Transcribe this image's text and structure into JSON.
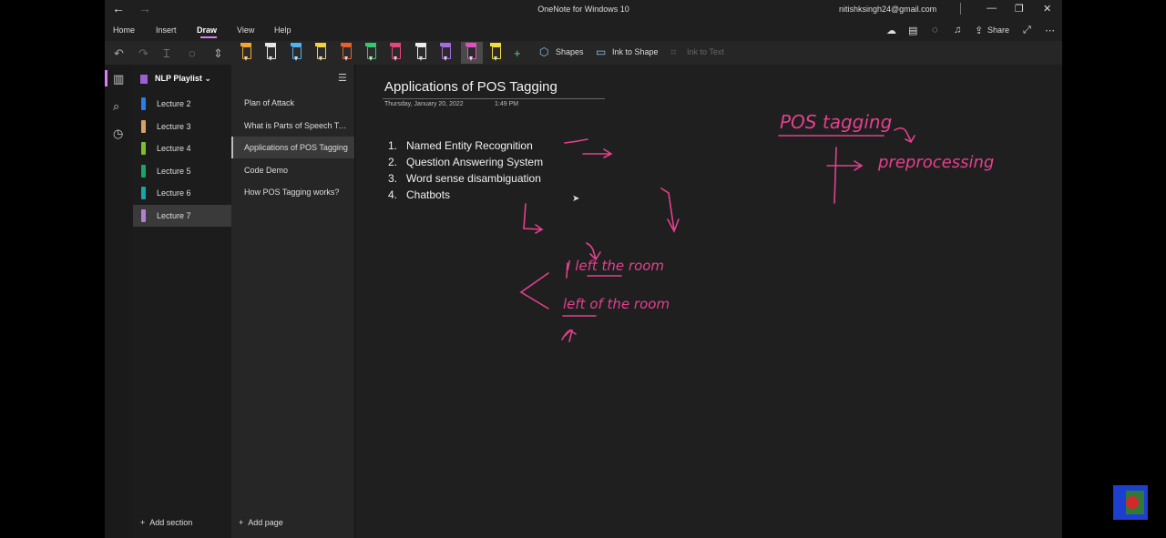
{
  "window": {
    "title": "OneNote for Windows 10",
    "account": "nitishksingh24@gmail.com"
  },
  "menu_tabs": [
    "Home",
    "Insert",
    "Draw",
    "View",
    "Help"
  ],
  "active_tab": "Draw",
  "top_actions": {
    "share_label": "Share"
  },
  "toolbar": {
    "pens": [
      {
        "color": "#f0a830"
      },
      {
        "color": "#e8e8e8"
      },
      {
        "color": "#4fb3ef"
      },
      {
        "color": "#f5d23a"
      },
      {
        "color": "#e8602c"
      },
      {
        "color": "#34c96c"
      },
      {
        "color": "#e8457f"
      },
      {
        "color": "#ececec"
      },
      {
        "color": "#a56be0"
      },
      {
        "color": "#e34ec0"
      },
      {
        "color": "#f2dd3a"
      }
    ],
    "selected_pen": 9,
    "shapes_label": "Shapes",
    "ink_to_shape_label": "Ink to Shape",
    "ink_to_text_label": "Ink to Text"
  },
  "notebook": {
    "name": "NLP Playlist"
  },
  "sections": [
    {
      "label": "Lecture 2",
      "color": "#2b7de9"
    },
    {
      "label": "Lecture 3",
      "color": "#d9a066"
    },
    {
      "label": "Lecture 4",
      "color": "#7dbf2e"
    },
    {
      "label": "Lecture 5",
      "color": "#1aa36b"
    },
    {
      "label": "Lecture 6",
      "color": "#1aa3a8"
    },
    {
      "label": "Lecture 7",
      "color": "#b27fd6"
    }
  ],
  "active_section": 5,
  "add_section_label": "Add section",
  "pages": [
    {
      "label": "Plan of Attack"
    },
    {
      "label": "What is Parts of Speech Ta..."
    },
    {
      "label": "Applications of POS Tagging"
    },
    {
      "label": "Code Demo"
    },
    {
      "label": "How POS Tagging works?"
    }
  ],
  "active_page": 2,
  "add_page_label": "Add page",
  "page": {
    "title": "Applications of POS Tagging",
    "date": "Thursday, January 20, 2022",
    "time": "1:49 PM",
    "list": [
      {
        "num": "1.",
        "text": "Named Entity Recognition"
      },
      {
        "num": "2.",
        "text": "Question Answering System"
      },
      {
        "num": "3.",
        "text": "Word sense disambiguation"
      },
      {
        "num": "4.",
        "text": "Chatbots"
      }
    ],
    "ink": {
      "color": "#e3408f",
      "pos_tagging": "POS tagging",
      "preprocessing": "preprocessing",
      "sentence1": "I left the room",
      "sentence2": "left of the room"
    }
  }
}
